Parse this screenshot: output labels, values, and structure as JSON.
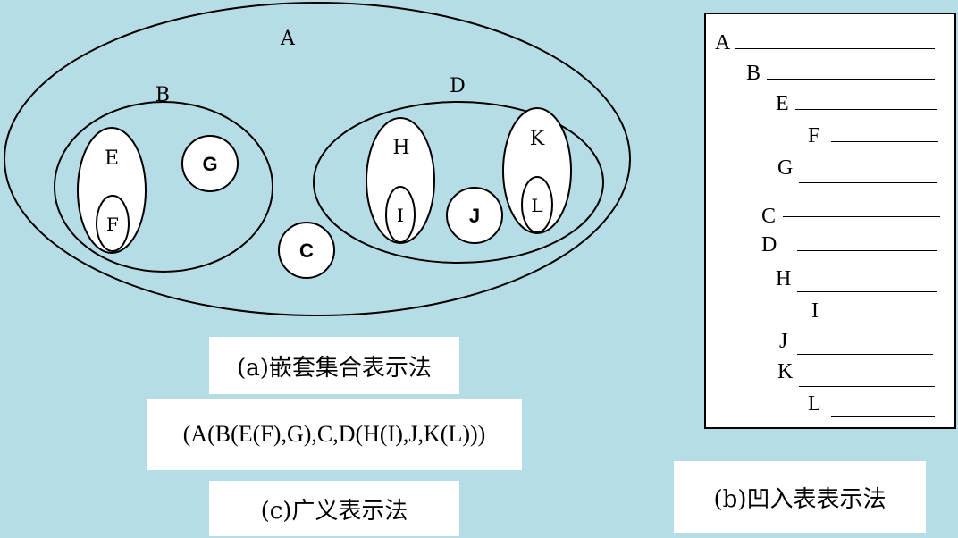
{
  "venn": {
    "sets": {
      "A": "A",
      "B": "B",
      "C": "C",
      "D": "D",
      "E": "E",
      "F": "F",
      "G": "G",
      "H": "H",
      "I": "I",
      "J": "J",
      "K": "K",
      "L": "L"
    }
  },
  "captions": {
    "nested": "(a)嵌套集合表示法",
    "generalized_expr": "(A(B(E(F),G),C,D(H(I),J,K(L)))",
    "generalized": "(c)广义表示法",
    "indented": "(b)凹入表表示法"
  },
  "indent_rows": [
    "A",
    "B",
    "E",
    "F",
    "G",
    "C",
    "D",
    "H",
    "I",
    "J",
    "K",
    "L"
  ]
}
